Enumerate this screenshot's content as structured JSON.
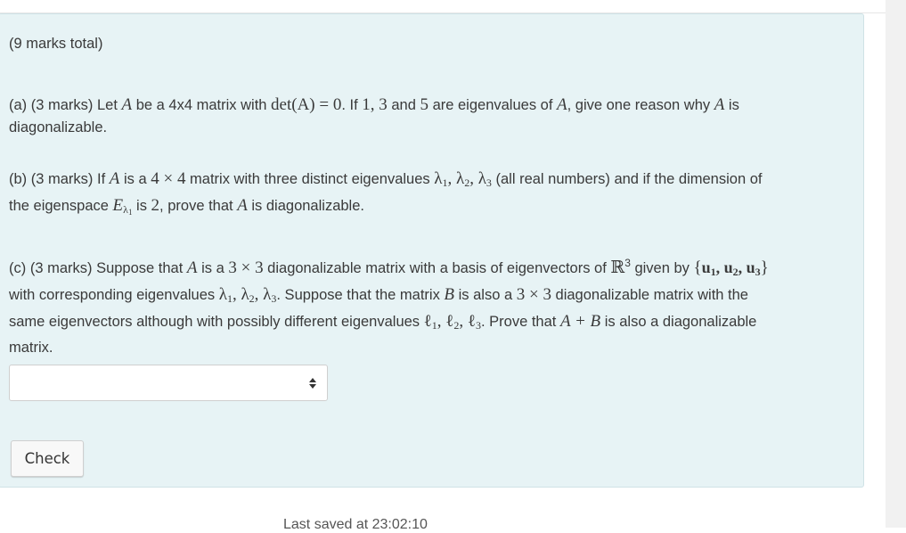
{
  "question": {
    "total": "(9 marks total)",
    "part_a": {
      "t1": "(a) (3 marks) Let ",
      "A1": "A",
      "t2": " be a 4x4 matrix with ",
      "det": "det(A) = 0",
      "t3": ". If ",
      "nums": "1, 3",
      "t4": " and ",
      "five": "5",
      "t5": " are eigenvalues of ",
      "A2": "A",
      "t6": ", give one reason why ",
      "A3": "A",
      "t7": " is",
      "t8": "diagonalizable."
    },
    "part_b": {
      "t1": "(b) (3 marks) If ",
      "A1": "A",
      "t2": " is a ",
      "dim": "4 × 4",
      "t3": " matrix with three distinct eigenvalues ",
      "lam": "λ",
      "s1": "1",
      "comma1": ", ",
      "s2": "2",
      "comma2": ", ",
      "s3": "3",
      "t4": " (all real numbers) and if the dimension of",
      "t5": "the eigenspace ",
      "E": "E",
      "Esub": "λ",
      "Esubsub": "1",
      "t6": " is ",
      "two": "2",
      "t7": ", prove that ",
      "A2": "A",
      "t8": " is diagonalizable."
    },
    "part_c": {
      "t1": "(c) (3 marks) Suppose that ",
      "A1": "A",
      "t2": " is a ",
      "dim1": "3 × 3",
      "t3": " diagonalizable matrix with a basis of eigenvectors of ",
      "R": "ℝ",
      "Rsup": "3",
      "t4": " given by ",
      "lbrace": "{",
      "u": "u",
      "rbrace": "}",
      "t5": "with corresponding eigenvalues ",
      "t6": ". Suppose that the matrix ",
      "B1": "B",
      "t7": " is also a ",
      "t8": " diagonalizable matrix with the",
      "t9": "same eigenvectors although with possibly different eigenvalues ",
      "ell": "ℓ",
      "t10": ". Prove that ",
      "sum": "A + B",
      "t11": " is also a diagonalizable",
      "t12": "matrix."
    }
  },
  "answer_select": {
    "value": ""
  },
  "check_button": {
    "label": "Check"
  },
  "footer": {
    "text": "Last saved at 23:02:10"
  }
}
